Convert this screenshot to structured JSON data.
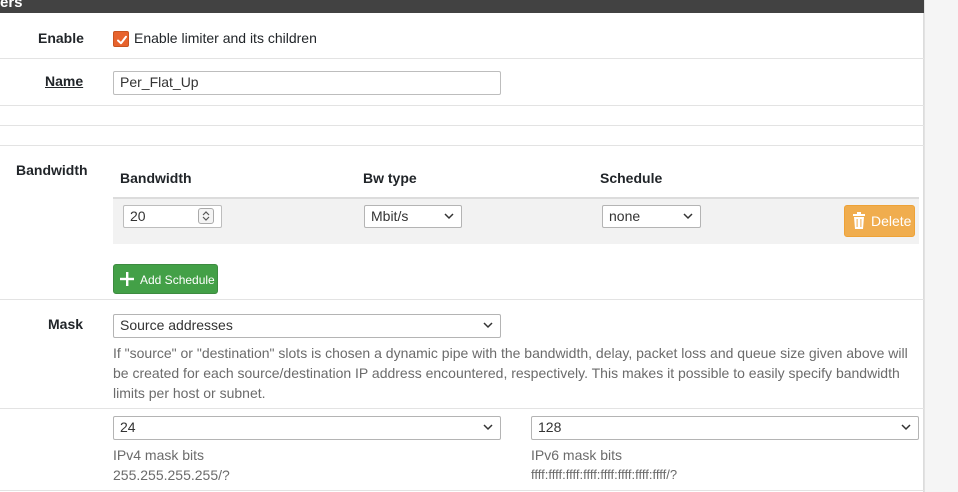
{
  "panel": {
    "header_title": "ers"
  },
  "enable": {
    "label": "Enable",
    "checkbox_label": "Enable limiter and its children",
    "checked": true
  },
  "name": {
    "label": "Name",
    "value": "Per_Flat_Up"
  },
  "bandwidth": {
    "section_label": "Bandwidth",
    "columns": {
      "bandwidth": "Bandwidth",
      "bw_type": "Bw type",
      "schedule": "Schedule"
    },
    "row": {
      "bandwidth_value": "20",
      "bw_type_value": "Mbit/s",
      "schedule_value": "none"
    },
    "delete_label": "Delete",
    "add_schedule_label": "Add Schedule"
  },
  "mask": {
    "label": "Mask",
    "value": "Source addresses",
    "help_lines": [
      "If \"source\" or \"destination\" slots is chosen a dynamic pipe with the bandwidth, delay, packet loss and queue size given above will",
      "be created for each source/destination IP address encountered, respectively. This makes it possible to easily specify bandwidth",
      "limits per host or subnet."
    ],
    "ipv4": {
      "value": "24",
      "label": "IPv4 mask bits",
      "hint": "255.255.255.255/?"
    },
    "ipv6": {
      "value": "128",
      "label": "IPv6 mask bits",
      "hint": "ffff:ffff:ffff:ffff:ffff:ffff:ffff:ffff/?"
    }
  },
  "colors": {
    "header_bg": "#424242",
    "checkbox": "#e7632d",
    "delete": "#f0ad4e",
    "add": "#43a047"
  },
  "icons": {
    "checkbox": "check-icon",
    "delete": "trash-icon",
    "add": "plus-icon",
    "select": "chevron-down-icon",
    "stepper": "spinner-arrows-icon"
  }
}
